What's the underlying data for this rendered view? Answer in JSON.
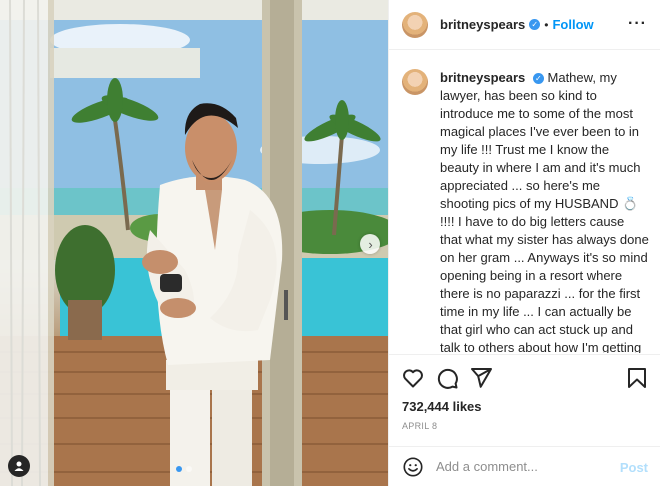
{
  "header": {
    "username": "britneyspears",
    "follow_label": "Follow",
    "more_icon": "more-horizontal-icon"
  },
  "caption": {
    "username": "britneyspears",
    "text": "Mathew, my lawyer, has been so kind to introduce me to some of the most magical places I've ever been to in my life !!! Trust me I know the beauty in where I am and it's much appreciated ... so here's me shooting pics of my HUSBAND 💍 !!!! I have to do big letters cause that what my sister has always done on her gram ... Anyways it's so mind opening being in a resort where there is no paparazzi ... for the first time in my life ... I can actually be that girl who can act stuck up and talk to others about how I'm getting married ... out at dinners 😂😂😂😂😂!!!! Acceptance and freedom are my key factors in my life at the moment and also loving this yummy man who I love so much !!! It's kinda"
  },
  "actions": {
    "like_icon": "heart-icon",
    "comment_icon": "comment-icon",
    "share_icon": "share-icon",
    "save_icon": "bookmark-icon"
  },
  "likes": "732,444 likes",
  "date": "APRIL 8",
  "comment": {
    "placeholder": "Add a comment...",
    "post_label": "Post"
  },
  "carousel": {
    "slide_count": 2,
    "active_slide": 1
  },
  "colors": {
    "link_blue": "#0095f6",
    "verified_blue": "#3897f0",
    "post_disabled": "#b2dffc",
    "muted_text": "#8e8e8e"
  }
}
